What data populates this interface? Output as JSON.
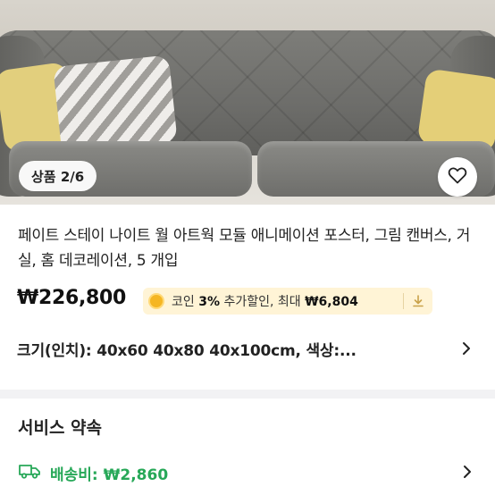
{
  "gallery": {
    "counter": "상품 2/6"
  },
  "product": {
    "title": "페이트 스테이 나이트 월 아트웍 모듈 애니메이션 포스터, 그림 캔버스, 거실, 홈 데코레이션, 5 개입",
    "price": "₩226,800"
  },
  "coin_promo": {
    "prefix": "코인 ",
    "percent": "3%",
    "middle": " 추가할인, 최대 ",
    "max_amount": "₩6,804"
  },
  "options": {
    "size_text": "크기(인치): 40x60 40x80 40x100cm, 색상:..."
  },
  "service": {
    "title": "서비스 약속",
    "shipping_label": "배송비: ₩2,860"
  },
  "colors": {
    "accent_green": "#27a858",
    "coin_bg": "#fff4d6"
  },
  "icons": {
    "favorite": "heart-icon",
    "coin": "coin-icon",
    "download": "download-icon",
    "chevron": "chevron-right-icon",
    "truck": "truck-icon"
  }
}
